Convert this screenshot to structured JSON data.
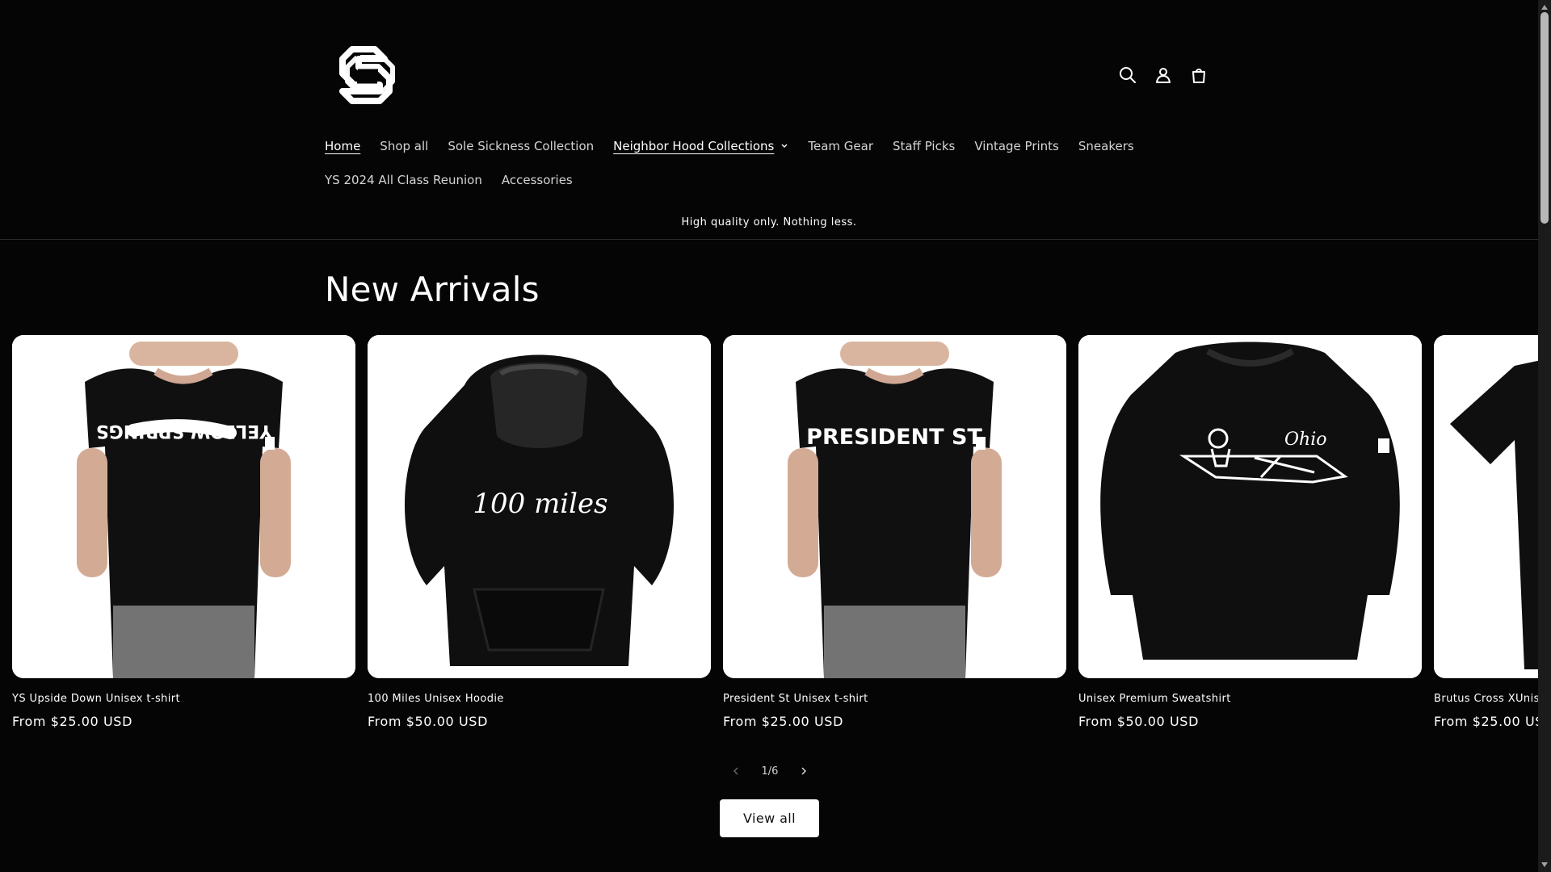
{
  "header": {
    "icons": [
      "search-icon",
      "account-icon",
      "cart-icon"
    ]
  },
  "nav": {
    "items": [
      {
        "label": "Home"
      },
      {
        "label": "Shop all"
      },
      {
        "label": "Sole Sickness Collection"
      },
      {
        "label": "Neighbor Hood Collections"
      },
      {
        "label": "Team Gear"
      },
      {
        "label": "Staff Picks"
      },
      {
        "label": "Vintage Prints"
      },
      {
        "label": "Sneakers"
      },
      {
        "label": "YS 2024 All Class Reunion"
      },
      {
        "label": "Accessories"
      }
    ]
  },
  "announcement": {
    "text": "High quality only. Nothing less."
  },
  "section": {
    "title": "New Arrivals"
  },
  "products": [
    {
      "name": "YS Upside Down Unisex t-shirt",
      "price": "From $25.00 USD",
      "image_print": "YELLOW SPRINGS"
    },
    {
      "name": "100 Miles Unisex Hoodie",
      "price": "From $50.00 USD",
      "image_print": "100 miles"
    },
    {
      "name": "President St Unisex t-shirt",
      "price": "From $25.00 USD",
      "image_print": "PRESIDENT ST"
    },
    {
      "name": "Unisex Premium Sweatshirt",
      "price": "From $50.00 USD",
      "image_print": "Ohio"
    },
    {
      "name": "Brutus Cross XUnis",
      "price": "From $25.00 US"
    }
  ],
  "pagination": {
    "text": "1/6"
  },
  "buttons": {
    "view_all": "View all"
  },
  "colors": {
    "background": "#050505",
    "text": "#ffffff",
    "button_bg": "#ffffff",
    "button_text": "#111111"
  }
}
